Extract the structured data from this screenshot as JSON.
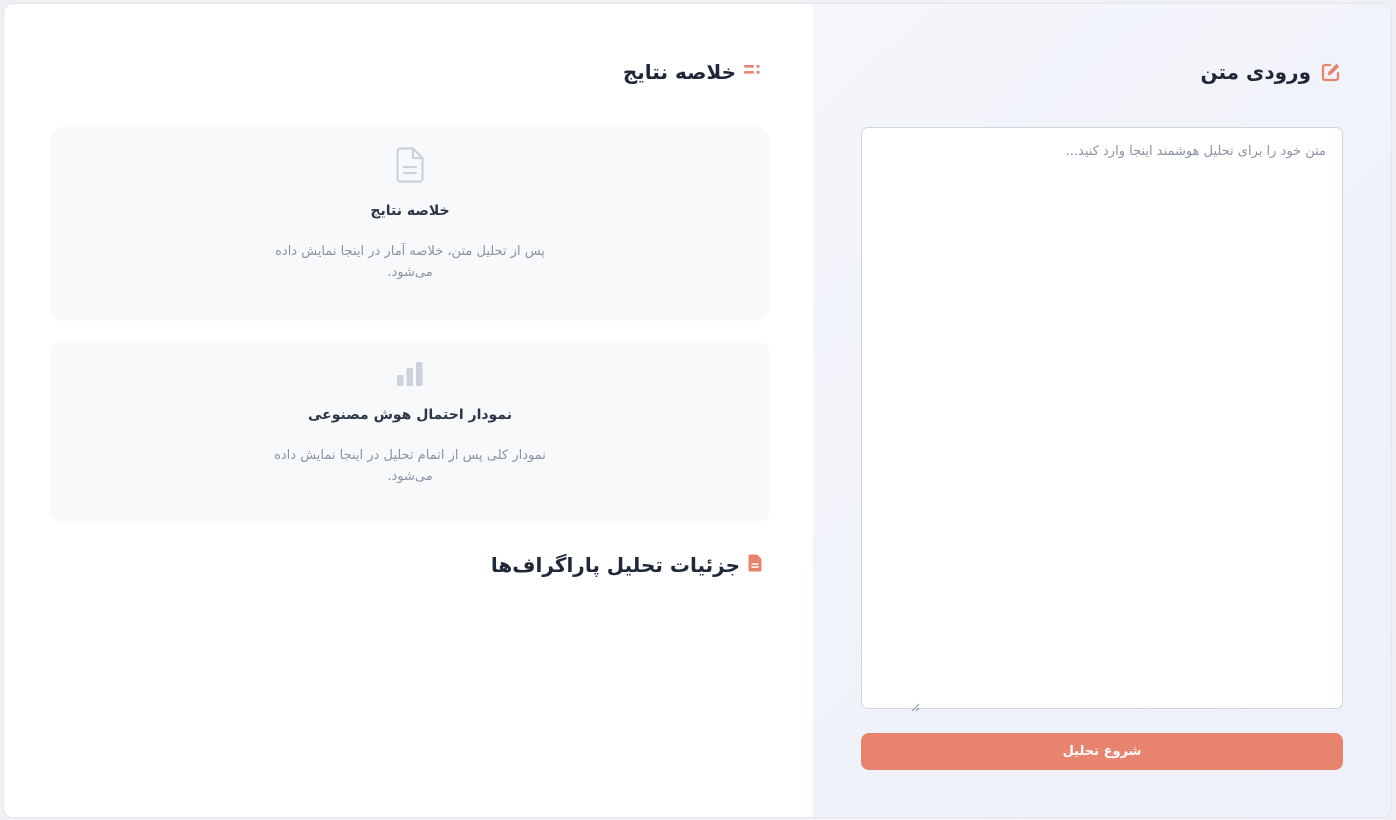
{
  "input_panel": {
    "title": "ورودی متن",
    "title_icon": "edit-icon",
    "textarea_value": "",
    "textarea_placeholder": "متن خود را برای تحلیل هوشمند اینجا وارد کنید...",
    "start_button_label": "شروع تحلیل"
  },
  "results_panel": {
    "summary_title": "خلاصه نتایج",
    "summary_title_icon": "list-icon",
    "summary_card": {
      "icon": "document-icon",
      "title": "خلاصه نتایج",
      "description": "پس از تحلیل متن، خلاصه آمار در اینجا نمایش داده می‌شود."
    },
    "chart_card": {
      "icon": "bar-chart-icon",
      "title": "نمودار احتمال هوش مصنوعی",
      "description": "نمودار کلی پس از اتمام تحلیل در اینجا نمایش داده می‌شود."
    },
    "details_title": "جزئیات تحلیل پاراگراف‌ها",
    "details_title_icon": "file-icon"
  },
  "colors": {
    "accent": "#e8846d",
    "heading": "#1e2838",
    "muted": "#8a93a3",
    "card_bg": "#f8f9fb",
    "icon_gray": "#cbd2dc"
  }
}
